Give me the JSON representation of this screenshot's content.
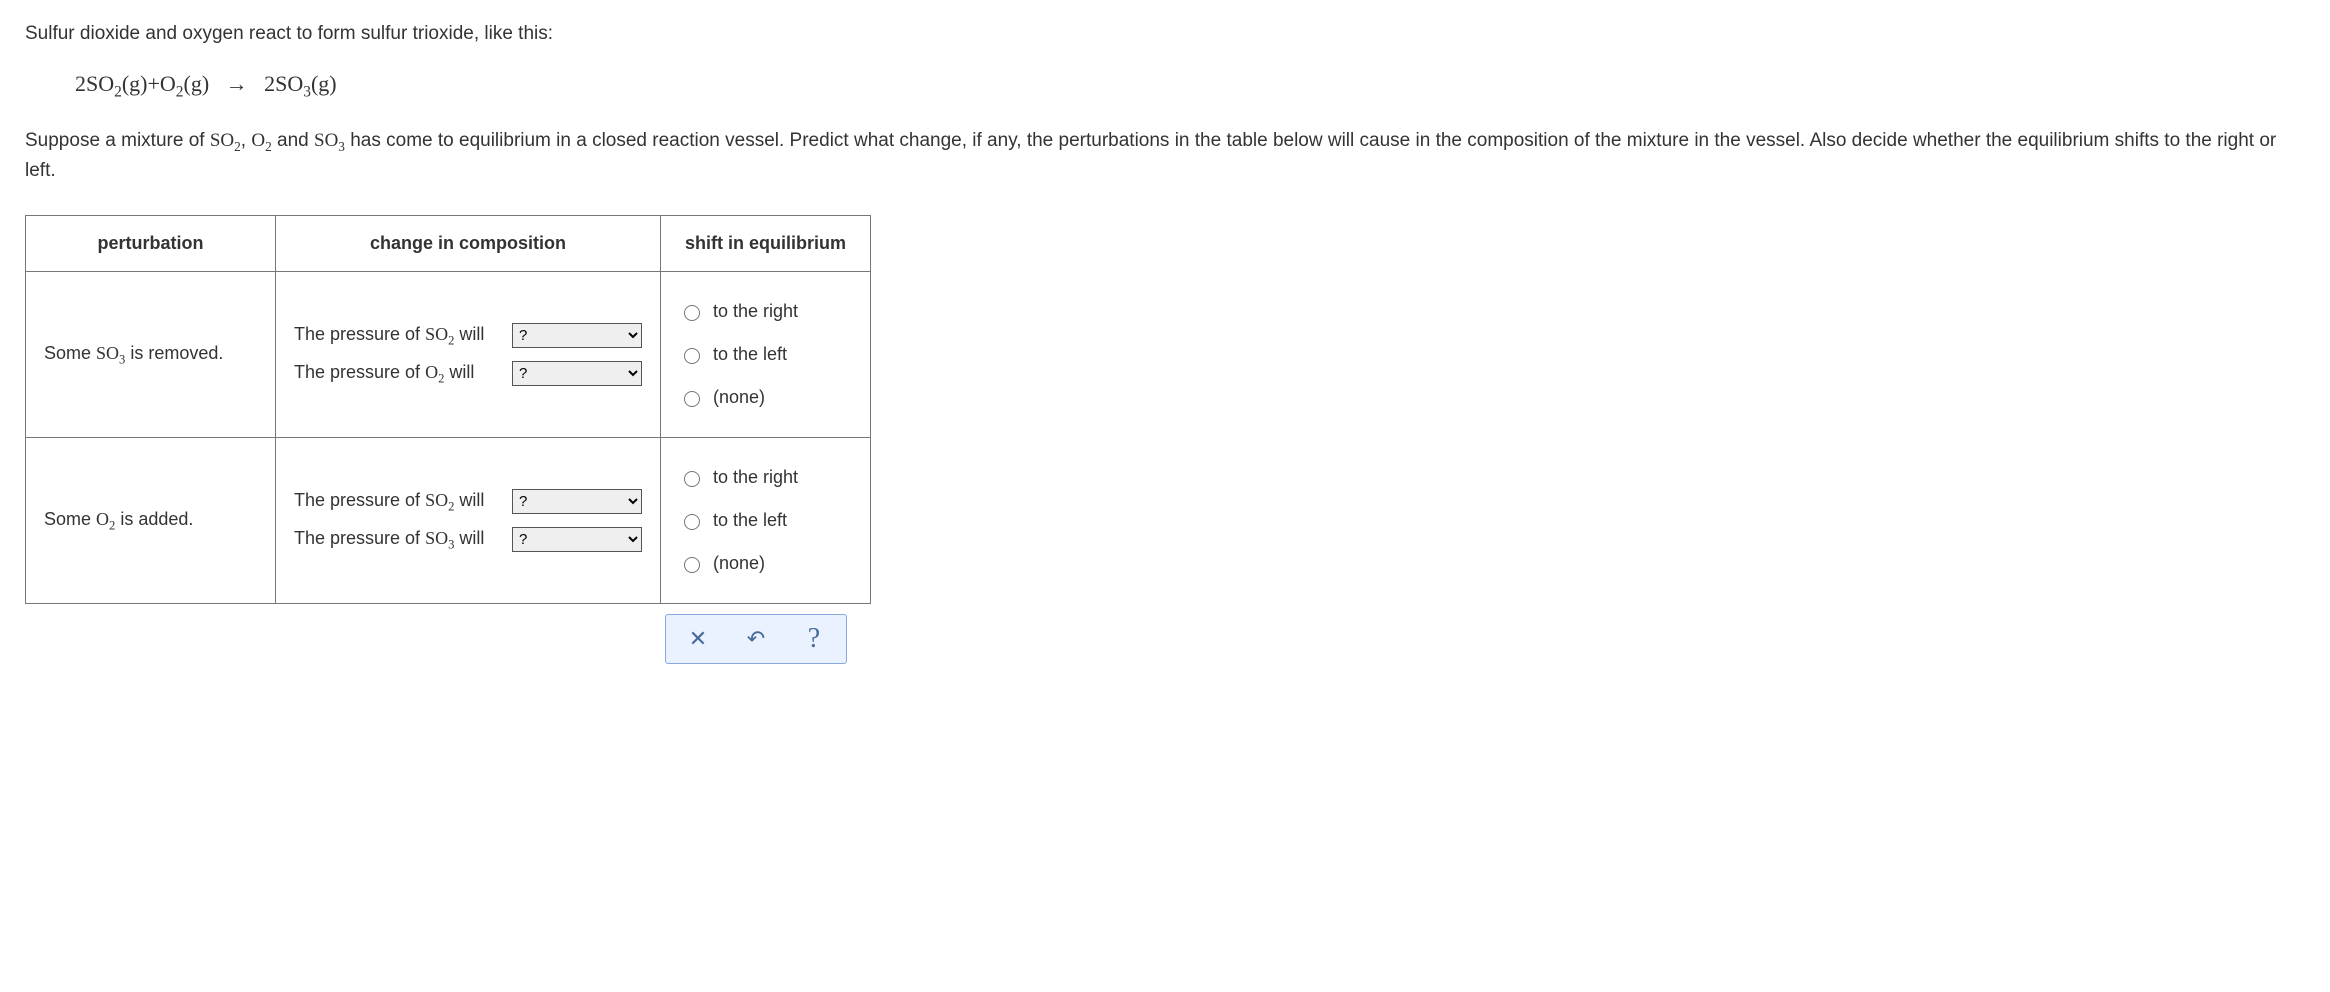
{
  "intro": {
    "line1": "Sulfur dioxide and oxygen react to form sulfur trioxide, like this:"
  },
  "equation": {
    "lhs1_coef": "2",
    "lhs1_base": "SO",
    "lhs1_sub": "2",
    "lhs1_phase": "(g)",
    "plus1": "+",
    "lhs2_base": "O",
    "lhs2_sub": "2",
    "lhs2_phase": "(g)",
    "arrow": "→",
    "rhs1_coef": "2",
    "rhs1_base": "SO",
    "rhs1_sub": "3",
    "rhs1_phase": "(g)"
  },
  "para2": {
    "pre": "Suppose a mixture of ",
    "s1_base": "SO",
    "s1_sub": "2",
    "s1_after": ", ",
    "s2_base": "O",
    "s2_sub": "2",
    "s2_after": " and ",
    "s3_base": "SO",
    "s3_sub": "3",
    "post": " has come to equilibrium in a closed reaction vessel. Predict what change, if any, the perturbations in the table below will cause in the composition of the mixture in the vessel. Also decide whether the equilibrium shifts to the right or left."
  },
  "headers": {
    "perturbation": "perturbation",
    "change": "change in composition",
    "shift": "shift in equilibrium"
  },
  "rows": [
    {
      "pert_pre": "Some ",
      "pert_base": "SO",
      "pert_sub": "3",
      "pert_post": " is removed.",
      "c1_pre": "The pressure of ",
      "c1_base": "SO",
      "c1_sub": "2",
      "c1_post": " will",
      "c2_pre": "The pressure of ",
      "c2_base": "O",
      "c2_sub": "2",
      "c2_post": " will"
    },
    {
      "pert_pre": "Some ",
      "pert_base": "O",
      "pert_sub": "2",
      "pert_post": " is added.",
      "c1_pre": "The pressure of ",
      "c1_base": "SO",
      "c1_sub": "2",
      "c1_post": " will",
      "c2_pre": "The pressure of ",
      "c2_base": "SO",
      "c2_sub": "3",
      "c2_post": " will"
    }
  ],
  "shift_options": {
    "right": "to the right",
    "left": "to the left",
    "none": "(none)"
  },
  "select_placeholder": "?",
  "buttons": {
    "close": "✕",
    "undo": "↶",
    "help": "?"
  }
}
